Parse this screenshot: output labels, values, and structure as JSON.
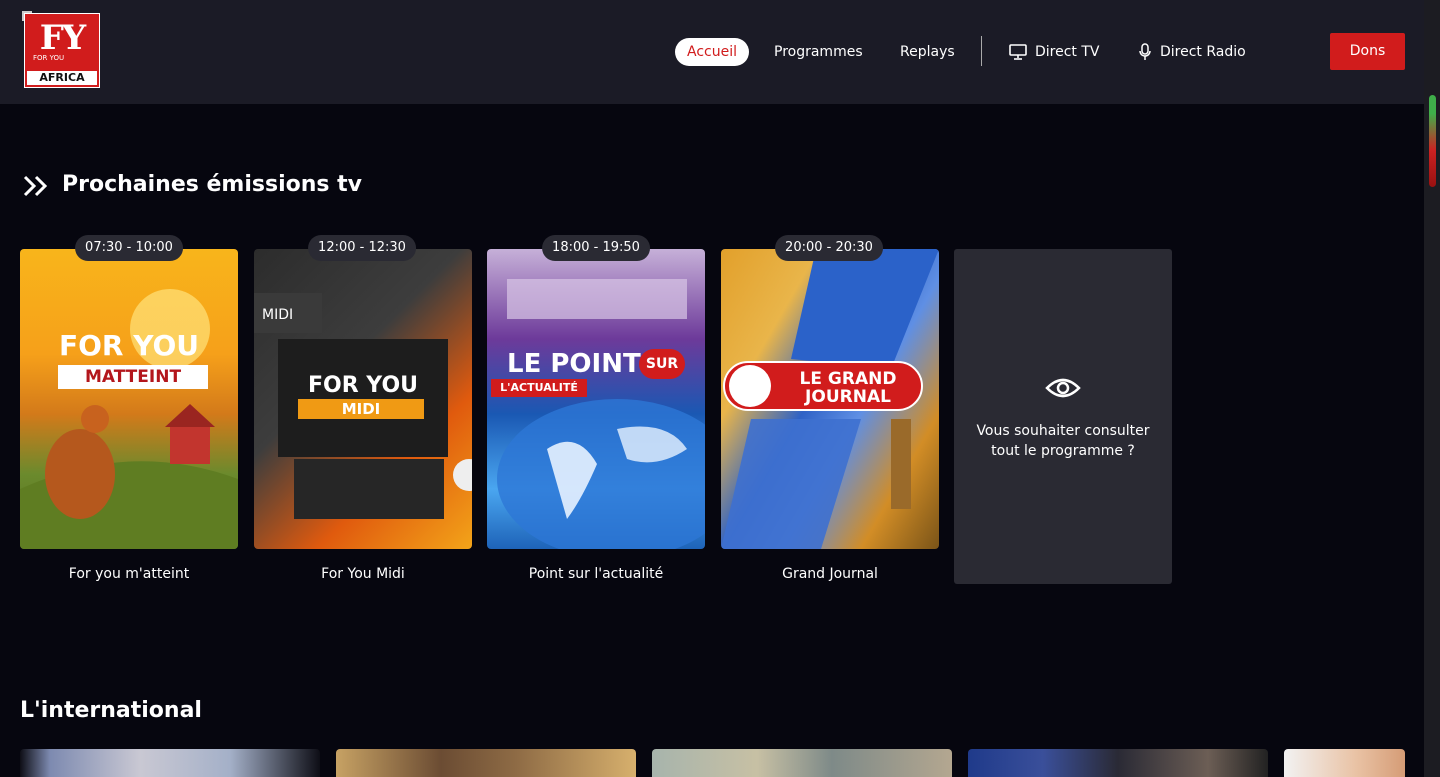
{
  "brand": {
    "logo_text": "FY",
    "logo_sub": "FOR YOU",
    "logo_africa": "AFRICA",
    "accent": "#d11c1c"
  },
  "nav": {
    "items": [
      {
        "label": "Accueil",
        "active": true
      },
      {
        "label": "Programmes",
        "active": false
      },
      {
        "label": "Replays",
        "active": false
      },
      {
        "label": "Direct TV",
        "icon": "tv-icon"
      },
      {
        "label": "Direct Radio",
        "icon": "microphone-icon"
      }
    ],
    "donate_label": "Dons"
  },
  "upcoming": {
    "title": "Prochaines émissions tv",
    "cards": [
      {
        "time": "07:30 - 10:00",
        "title": "For you m'atteint",
        "art_line1": "FOR YOU",
        "art_line2": "MATTEINT"
      },
      {
        "time": "12:00 - 12:30",
        "title": "For You Midi",
        "art_line1": "FOR YOU",
        "art_line2": "MIDI",
        "art_tag": "MIDI"
      },
      {
        "time": "18:00 - 19:50",
        "title": "Point sur l'actualité",
        "art_line1": "LE POINT",
        "art_line2": "L'ACTUALITÉ",
        "art_badge": "SUR"
      },
      {
        "time": "20:00 - 20:30",
        "title": "Grand Journal",
        "art_line1": "LE GRAND",
        "art_line2": "JOURNAL"
      }
    ],
    "program_prompt": "Vous souhaiter consulter tout le programme ?"
  },
  "international": {
    "title": "L'international"
  }
}
